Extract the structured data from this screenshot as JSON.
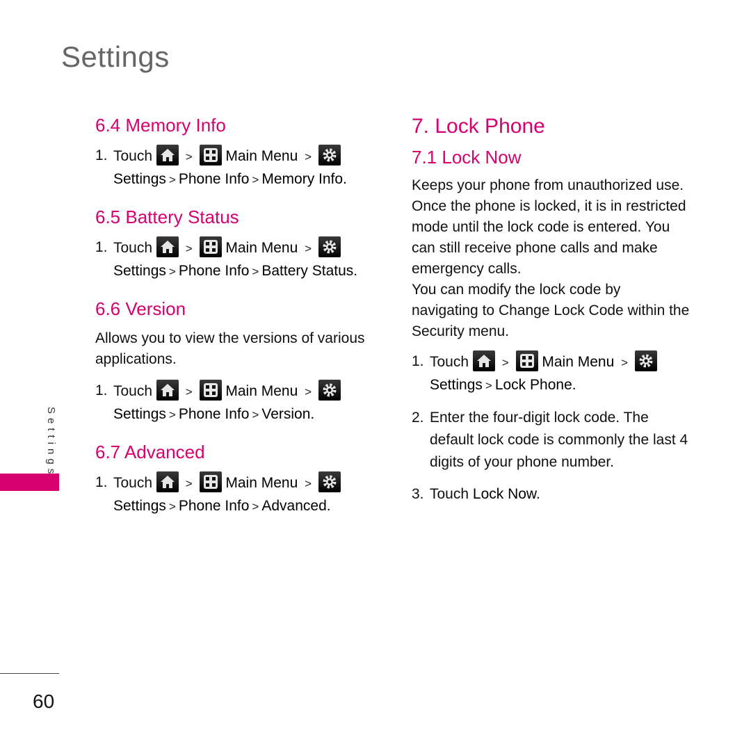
{
  "page": {
    "title": "Settings",
    "side_tab_label": "Settings",
    "page_number": "60",
    "accent_color": "#d6006f"
  },
  "common": {
    "touch": "Touch",
    "sep": ">",
    "main_menu": "Main Menu",
    "settings": "Settings",
    "phone_info": "Phone Info",
    "icons": [
      "home-icon",
      "main-menu-grid-icon",
      "settings-gear-icon"
    ]
  },
  "left": {
    "sections": [
      {
        "heading": "6.4 Memory Info",
        "step_num": "1.",
        "target": "Memory Info."
      },
      {
        "heading": "6.5 Battery Status",
        "step_num": "1.",
        "target": "Battery Status."
      },
      {
        "heading": "6.6 Version",
        "description": "Allows you to view the versions of various applications.",
        "step_num": "1.",
        "target": "Version."
      },
      {
        "heading": "6.7 Advanced",
        "step_num": "1.",
        "target": "Advanced."
      }
    ]
  },
  "right": {
    "heading": "7. Lock Phone",
    "subheading": "7.1 Lock Now",
    "para1": "Keeps your phone from unauthorized use. Once the phone is locked, it is in restricted mode until the lock code is entered. You can still receive phone calls and make emergency calls.",
    "para2_pre": "You can modify the lock code by navigating to",
    "para2_bold": "Change Lock Code",
    "para2_post": "within the Security menu.",
    "steps": [
      {
        "num": "1.",
        "target": "Lock Phone."
      },
      {
        "num": "2.",
        "text": "Enter the four-digit lock code. The default lock code is commonly the last 4 digits of your phone number."
      },
      {
        "num": "3.",
        "pre": "Touch",
        "bold": "Lock Now",
        "post": "."
      }
    ]
  }
}
